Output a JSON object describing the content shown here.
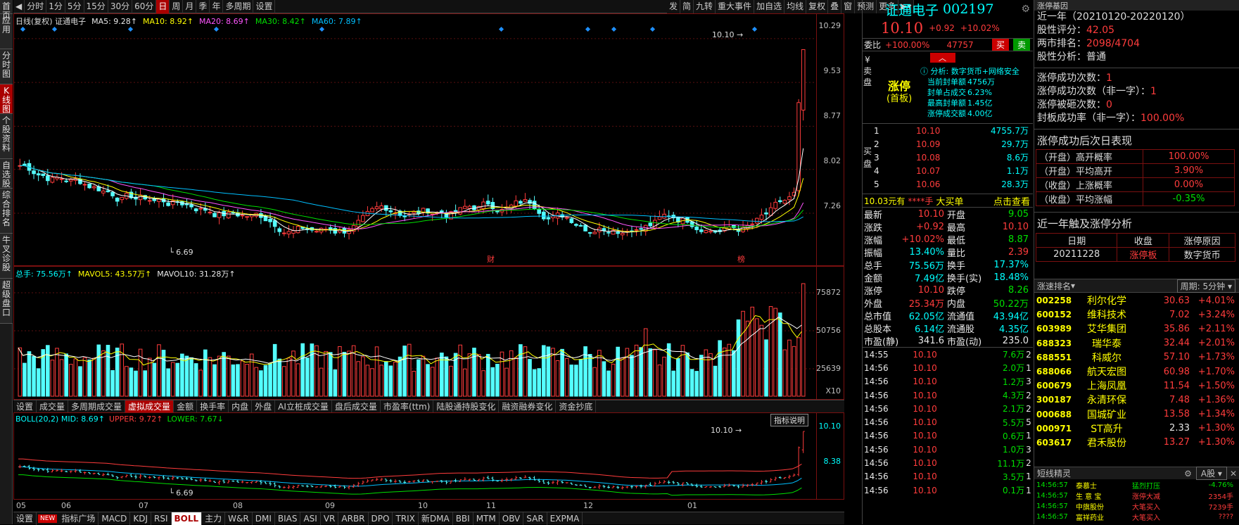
{
  "left_nav": [
    "首页",
    "应用",
    "分时图",
    "K线图",
    "个股资料",
    "自选股",
    "综合排名",
    "牛叉诊股",
    "超级盘口"
  ],
  "period_tabs": [
    "分时",
    "1分",
    "5分",
    "15分",
    "30分",
    "60分",
    "日",
    "周",
    "月",
    "季",
    "年",
    "多周期",
    "设置"
  ],
  "top_right_tabs": [
    "发",
    "简",
    "九转",
    "重大事件",
    "加自选",
    "均线",
    "复权",
    "叠",
    "窗",
    "预测",
    "更多"
  ],
  "kline": {
    "header": "日线(复权) 证通电子",
    "ma5": "MA5: 9.28↑",
    "ma10": "MA10: 8.92↑",
    "ma20": "MA20: 8.69↑",
    "ma30": "MA30: 8.42↑",
    "ma60": "MA60: 7.89↑",
    "yaxis": [
      "10.29",
      "9.53",
      "8.77",
      "8.02",
      "7.26"
    ],
    "high_label": "10.10",
    "low_label": "6.69",
    "marker_cai": "财",
    "marker_bang": "榜",
    "colors": {
      "up": "#ff3c3c",
      "down": "#54ffff",
      "ma5": "#ffffff",
      "ma10": "#ffff00",
      "ma20": "#ff55ff",
      "ma30": "#00e000",
      "ma60": "#00bfff"
    }
  },
  "volume": {
    "header": "总手: 75.56万↑",
    "mavol5": "MAVOL5: 43.57万↑",
    "mavol10": "MAVOL10: 31.28万↑",
    "yaxis": [
      "75872",
      "50756",
      "25639"
    ],
    "unit": "X10"
  },
  "indicator_tabs": [
    "设置",
    "成交量",
    "多周期成交量",
    "虚拟成交量",
    "金额",
    "换手率",
    "内盘",
    "外盘",
    "AI立桩成交量",
    "盘后成交量",
    "市盈率(ttm)",
    "陆股通持股变化",
    "融资融券变化",
    "资金抄底"
  ],
  "boll": {
    "header": "BOLL(20,2) MID: 8.69↑",
    "upper": "UPPER: 9.72↑",
    "lower": "LOWER: 7.67↓",
    "yaxis": [
      "10.10",
      "8.38"
    ],
    "explain_btn": "指标说明",
    "high_label": "10.10",
    "low_label": "6.69"
  },
  "xaxis": [
    "05",
    "06",
    "07",
    "08",
    "09",
    "10",
    "11",
    "12",
    "01"
  ],
  "bottom_tabs": [
    "设置",
    "指标广场",
    "MACD",
    "KDJ",
    "RSI",
    "BOLL",
    "主力",
    "W&R",
    "DMI",
    "BIAS",
    "ASI",
    "VR",
    "ARBR",
    "DPO",
    "TRIX",
    "新DMA",
    "BBI",
    "MTM",
    "OBV",
    "SAR",
    "EXPMA"
  ],
  "new_badge": "NEW",
  "quote": {
    "name": "证通电子",
    "code": "002197",
    "price": "10.10",
    "change": "+0.92",
    "pct": "+10.02%",
    "weibi_label": "委比",
    "weibi": "+100.00%",
    "weibi_vol": "47757",
    "buy_btn": "买",
    "sell_btn": "卖",
    "limit_title": "涨停",
    "limit_sub": "(首板)",
    "analysis": "分析: 数字货币+网络安全",
    "limit_info": [
      [
        "当前封单额",
        "4756万"
      ],
      [
        "封单占成交",
        "6.23%"
      ],
      [
        "最高封单额",
        "1.45亿"
      ],
      [
        "涨停成交额",
        "4.00亿"
      ]
    ],
    "sell_side_label": "卖盘",
    "buy_side_label": "买盘",
    "buy_levels": [
      [
        "1",
        "10.10",
        "4755.7万"
      ],
      [
        "2",
        "10.09",
        "29.7万"
      ],
      [
        "3",
        "10.08",
        "8.6万"
      ],
      [
        "4",
        "10.07",
        "1.1万"
      ],
      [
        "5",
        "10.06",
        "28.3万"
      ]
    ],
    "bigorder": {
      "price": "10.03元有",
      "star": "****手",
      "label": "大买单",
      "link": "点击查看"
    },
    "stats": [
      [
        "最新",
        "10.10",
        "开盘",
        "9.05"
      ],
      [
        "涨跌",
        "+0.92",
        "最高",
        "10.10"
      ],
      [
        "涨幅",
        "+10.02%",
        "最低",
        "8.87"
      ],
      [
        "振幅",
        "13.40%",
        "量比",
        "2.39"
      ],
      [
        "总手",
        "75.56万",
        "换手",
        "17.37%"
      ],
      [
        "金额",
        "7.49亿",
        "换手(实)",
        "18.48%"
      ],
      [
        "涨停",
        "10.10",
        "跌停",
        "8.26"
      ],
      [
        "外盘",
        "25.34万",
        "内盘",
        "50.22万"
      ],
      [
        "总市值",
        "62.05亿",
        "流通值",
        "43.94亿"
      ],
      [
        "总股本",
        "6.14亿",
        "流通股",
        "4.35亿"
      ],
      [
        "市盈(静)",
        "341.6",
        "市盈(动)",
        "235.0"
      ]
    ],
    "ticks": [
      [
        "14:55",
        "10.10",
        "7.6万",
        "2"
      ],
      [
        "14:56",
        "10.10",
        "2.0万",
        "1"
      ],
      [
        "14:56",
        "10.10",
        "1.2万",
        "3"
      ],
      [
        "14:56",
        "10.10",
        "4.3万",
        "2"
      ],
      [
        "14:56",
        "10.10",
        "2.1万",
        "2"
      ],
      [
        "14:56",
        "10.10",
        "5.5万",
        "5"
      ],
      [
        "14:56",
        "10.10",
        "0.6万",
        "1"
      ],
      [
        "14:56",
        "10.10",
        "1.0万",
        "3"
      ],
      [
        "14:56",
        "10.10",
        "11.1万",
        "2"
      ],
      [
        "14:56",
        "10.10",
        "3.5万",
        "1"
      ],
      [
        "14:56",
        "10.10",
        "0.1万",
        "1"
      ]
    ]
  },
  "gene": {
    "title": "涨停基因",
    "period": "近一年（20210120-20220120）",
    "score_label": "股性评分：",
    "score": "42.05",
    "rank_label": "两市排名：",
    "rank": "2098/4704",
    "analysis_label": "股性分析：",
    "analysis": "普通",
    "stats": [
      [
        "涨停成功次数：",
        "1"
      ],
      [
        "涨停成功次数（非一字）：",
        "1"
      ],
      [
        "涨停被砸次数：",
        "0"
      ],
      [
        "封板成功率（非一字）：",
        "100.00%"
      ]
    ],
    "next_title": "涨停成功后次日表现",
    "next": [
      [
        "（开盘）高开概率",
        "100.00%"
      ],
      [
        "（开盘）平均高开",
        "3.90%"
      ],
      [
        "（收盘）上涨概率",
        "0.00%"
      ],
      [
        "（收盘）平均涨幅",
        "-0.35%"
      ]
    ],
    "touch_title": "近一年触及涨停分析",
    "touch_head": [
      "日期",
      "收盘",
      "涨停原因"
    ],
    "touch_rows": [
      [
        "20211228",
        "涨停板",
        "数字货币"
      ]
    ]
  },
  "rank": {
    "title": "涨速排名",
    "period": "周期: 5分钟",
    "rows": [
      [
        "002258",
        "利尔化学",
        "30.63",
        "+4.01%"
      ],
      [
        "600152",
        "维科技术",
        "7.02",
        "+3.24%"
      ],
      [
        "603989",
        "艾华集团",
        "35.86",
        "+2.11%"
      ],
      [
        "688323",
        "瑞华泰",
        "32.44",
        "+2.01%"
      ],
      [
        "688551",
        "科威尔",
        "57.10",
        "+1.73%"
      ],
      [
        "688066",
        "航天宏图",
        "60.98",
        "+1.70%"
      ],
      [
        "600679",
        "上海凤凰",
        "11.54",
        "+1.50%"
      ],
      [
        "300187",
        "永清环保",
        "7.48",
        "+1.36%"
      ],
      [
        "000688",
        "国城矿业",
        "13.58",
        "+1.34%"
      ],
      [
        "000971",
        "ST高升",
        "2.33",
        "+1.30%"
      ],
      [
        "603617",
        "君禾股份",
        "13.27",
        "+1.30%"
      ]
    ]
  },
  "sprite": {
    "title": "短线精灵",
    "mode": "A股",
    "rows": [
      [
        "14:56:57",
        "泰慕士",
        "猛烈打压",
        "-4.76%"
      ],
      [
        "14:56:57",
        "生 意 宝",
        "涨停大减",
        "2354手"
      ],
      [
        "14:56:57",
        "中旗股份",
        "大笔买入",
        "7239手"
      ],
      [
        "14:56:57",
        "富祥药业",
        "大笔买入",
        "????"
      ]
    ]
  }
}
